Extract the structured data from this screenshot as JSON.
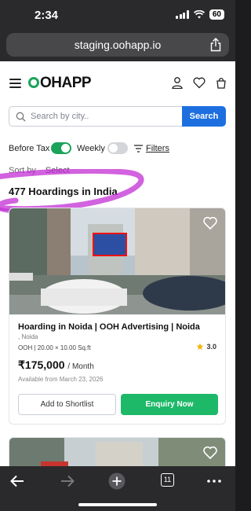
{
  "status": {
    "time": "2:34",
    "battery": "60"
  },
  "browser": {
    "url": "staging.oohapp.io",
    "tab_count": "11"
  },
  "header": {
    "logo": "OHAPP"
  },
  "search": {
    "placeholder": "Search by city..",
    "button": "Search"
  },
  "filters": {
    "before_tax": "Before Tax",
    "before_tax_on": true,
    "weekly": "Weekly",
    "weekly_on": false,
    "filters_label": "Filters"
  },
  "sort": {
    "label": "Sort by",
    "select": "Select"
  },
  "results": {
    "count_text": "477 Hoardings in India"
  },
  "listing": {
    "title": "Hoarding in Noida | OOH Advertising | Noida",
    "location": ", Noida",
    "meta": "OOH | 20.00 × 10.00 Sq.ft",
    "rating": "3.0",
    "price": "₹175,000",
    "price_unit": "/ Month",
    "available": "Available from March 23, 2026",
    "shortlist_label": "Add to Shortlist",
    "enquiry_label": "Enquiry Now"
  },
  "colors": {
    "accent_green": "#1db969",
    "search_blue": "#1d6fe0",
    "annotation": "#c026d3"
  }
}
